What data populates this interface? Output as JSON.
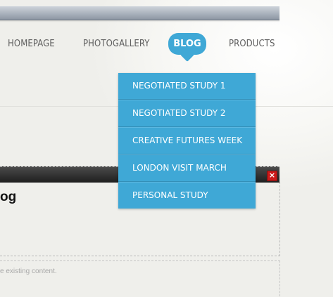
{
  "nav": {
    "items": [
      {
        "label": "HOMEPAGE"
      },
      {
        "label": "PHOTOGALLERY"
      },
      {
        "label": "BLOG"
      },
      {
        "label": "PRODUCTS"
      }
    ],
    "active": "BLOG"
  },
  "dropdown": {
    "items": [
      {
        "label": "NEGOTIATED STUDY 1"
      },
      {
        "label": "NEGOTIATED STUDY 2"
      },
      {
        "label": "CREATIVE FUTURES WEEK"
      },
      {
        "label": "LONDON VISIT MARCH"
      },
      {
        "label": "PERSONAL STUDY"
      }
    ]
  },
  "panel": {
    "title": "og",
    "close_symbol": "×",
    "hint": "e existing content."
  },
  "colors": {
    "accent": "#3fa8d6",
    "close_button": "#cc1a1a"
  }
}
